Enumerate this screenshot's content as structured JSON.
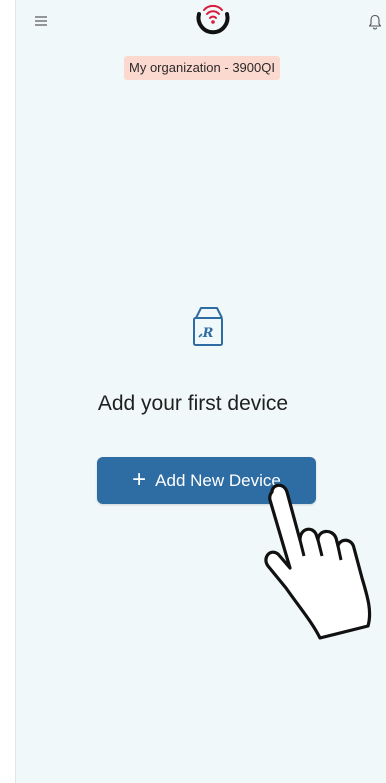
{
  "header": {
    "menu_icon": "hamburger-menu-icon",
    "logo_icon": "wifi-logo-icon",
    "notification_icon": "bell-icon"
  },
  "organization": {
    "label": "My organization - 3900QI"
  },
  "empty_state": {
    "icon": "device-box-icon",
    "title": "Add your first device",
    "button_label": "Add New Device",
    "button_icon": "plus-icon"
  },
  "overlay": {
    "cursor_icon": "hand-pointer-icon"
  },
  "colors": {
    "background": "#f1f8f9",
    "accent": "#2e6ca4",
    "badge_bg": "#fbd9cf",
    "logo_red": "#d81b3c"
  }
}
